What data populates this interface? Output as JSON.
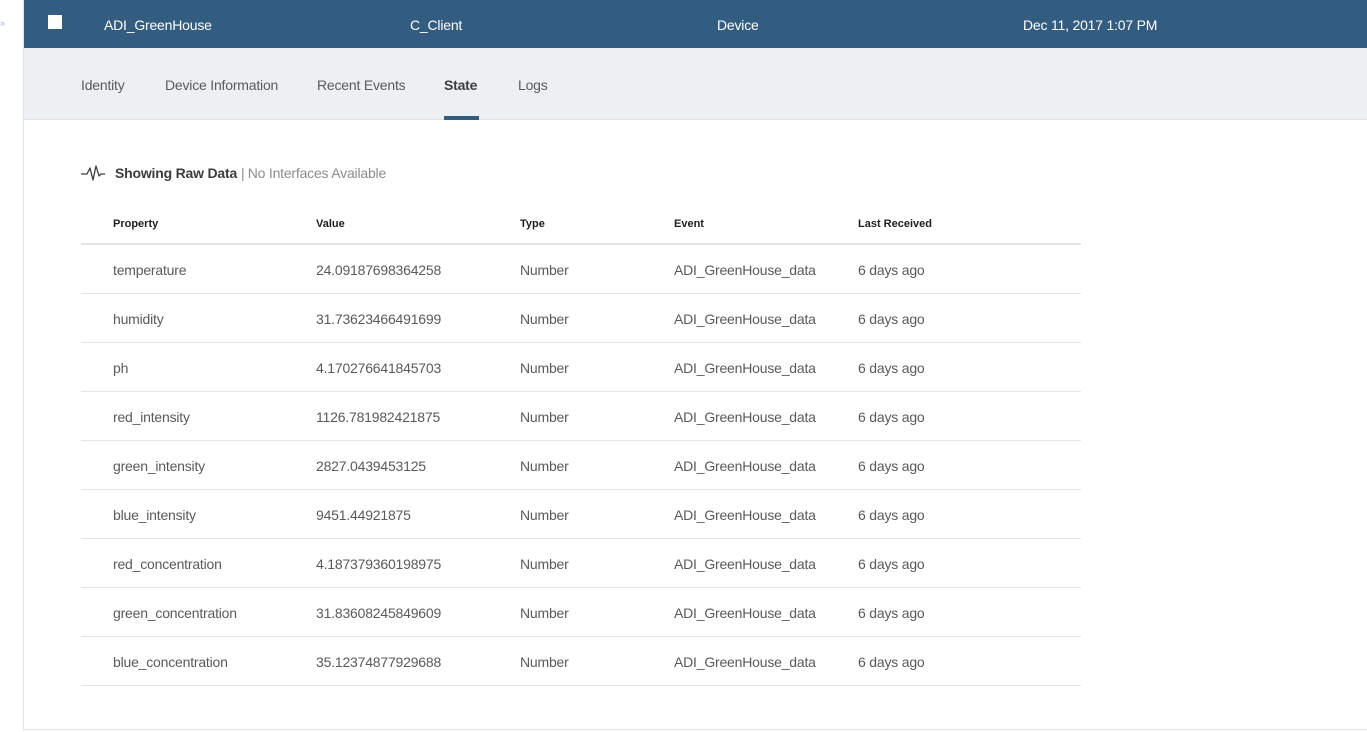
{
  "header": {
    "name": "ADI_GreenHouse",
    "type": "C_Client",
    "class": "Device",
    "date": "Dec 11, 2017 1:07 PM",
    "background": "#325c80"
  },
  "tabs": [
    {
      "label": "Identity",
      "active": false
    },
    {
      "label": "Device Information",
      "active": false
    },
    {
      "label": "Recent Events",
      "active": false
    },
    {
      "label": "State",
      "active": true
    },
    {
      "label": "Logs",
      "active": false
    }
  ],
  "raw_data": {
    "icon": "pulse-icon",
    "title": "Showing Raw Data",
    "separator": "|",
    "subtitle": "No Interfaces Available"
  },
  "table": {
    "columns": [
      "Property",
      "Value",
      "Type",
      "Event",
      "Last Received"
    ],
    "rows": [
      {
        "property": "temperature",
        "value": "24.09187698364258",
        "type": "Number",
        "event": "ADI_GreenHouse_data",
        "last": "6 days ago"
      },
      {
        "property": "humidity",
        "value": "31.73623466491699",
        "type": "Number",
        "event": "ADI_GreenHouse_data",
        "last": "6 days ago"
      },
      {
        "property": "ph",
        "value": "4.170276641845703",
        "type": "Number",
        "event": "ADI_GreenHouse_data",
        "last": "6 days ago"
      },
      {
        "property": "red_intensity",
        "value": "1126.781982421875",
        "type": "Number",
        "event": "ADI_GreenHouse_data",
        "last": "6 days ago"
      },
      {
        "property": "green_intensity",
        "value": "2827.0439453125",
        "type": "Number",
        "event": "ADI_GreenHouse_data",
        "last": "6 days ago"
      },
      {
        "property": "blue_intensity",
        "value": "9451.44921875",
        "type": "Number",
        "event": "ADI_GreenHouse_data",
        "last": "6 days ago"
      },
      {
        "property": "red_concentration",
        "value": "4.187379360198975",
        "type": "Number",
        "event": "ADI_GreenHouse_data",
        "last": "6 days ago"
      },
      {
        "property": "green_concentration",
        "value": "31.83608245849609",
        "type": "Number",
        "event": "ADI_GreenHouse_data",
        "last": "6 days ago"
      },
      {
        "property": "blue_concentration",
        "value": "35.12374877929688",
        "type": "Number",
        "event": "ADI_GreenHouse_data",
        "last": "6 days ago"
      }
    ]
  }
}
